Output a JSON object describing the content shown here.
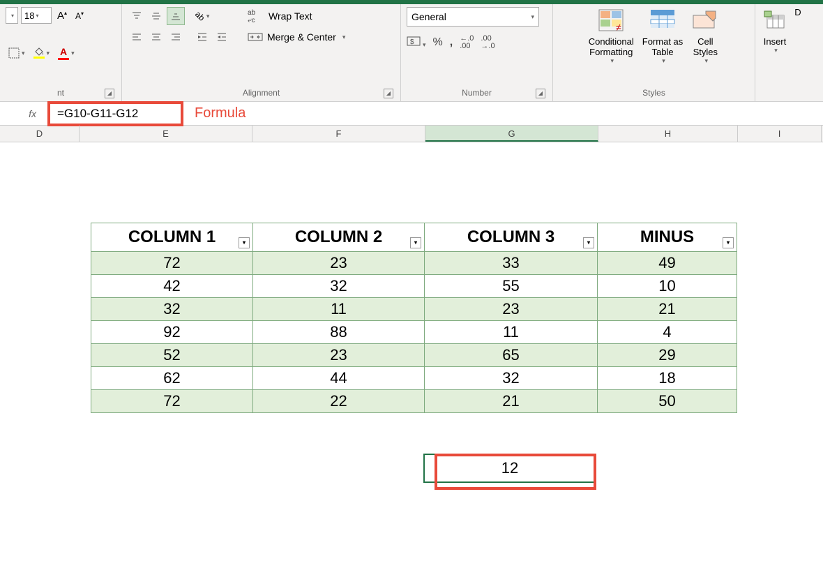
{
  "ribbon": {
    "font": {
      "size": "18",
      "group_label": "nt"
    },
    "alignment": {
      "wrap_label": "Wrap Text",
      "merge_label": "Merge & Center",
      "group_label": "Alignment"
    },
    "number": {
      "format": "General",
      "group_label": "Number"
    },
    "styles": {
      "cond_format": "Conditional\nFormatting",
      "format_table": "Format as\nTable",
      "cell_styles": "Cell\nStyles",
      "group_label": "Styles"
    },
    "cells": {
      "insert": "Insert",
      "delete_initial": "D"
    }
  },
  "formula_bar": {
    "fx": "fx",
    "formula": "=G10-G11-G12",
    "annotation": "Formula"
  },
  "columns": [
    "D",
    "E",
    "F",
    "G",
    "H",
    "I"
  ],
  "table": {
    "headers": [
      "COLUMN 1",
      "COLUMN 2",
      "COLUMN 3",
      "MINUS"
    ],
    "rows": [
      [
        "72",
        "23",
        "33",
        "49"
      ],
      [
        "42",
        "32",
        "55",
        "10"
      ],
      [
        "32",
        "11",
        "23",
        "21"
      ],
      [
        "92",
        "88",
        "11",
        "4"
      ],
      [
        "52",
        "23",
        "65",
        "29"
      ],
      [
        "62",
        "44",
        "32",
        "18"
      ],
      [
        "72",
        "22",
        "21",
        "50"
      ]
    ]
  },
  "selected_cell_value": "12",
  "chart_data": {
    "type": "table",
    "title": "Column subtraction example",
    "headers": [
      "COLUMN 1",
      "COLUMN 2",
      "COLUMN 3",
      "MINUS"
    ],
    "rows": [
      [
        72,
        23,
        33,
        49
      ],
      [
        42,
        32,
        55,
        10
      ],
      [
        32,
        11,
        23,
        21
      ],
      [
        92,
        88,
        11,
        4
      ],
      [
        52,
        23,
        65,
        29
      ],
      [
        62,
        44,
        32,
        18
      ],
      [
        72,
        22,
        21,
        50
      ]
    ],
    "formula_result": 12,
    "formula": "=G10-G11-G12"
  }
}
